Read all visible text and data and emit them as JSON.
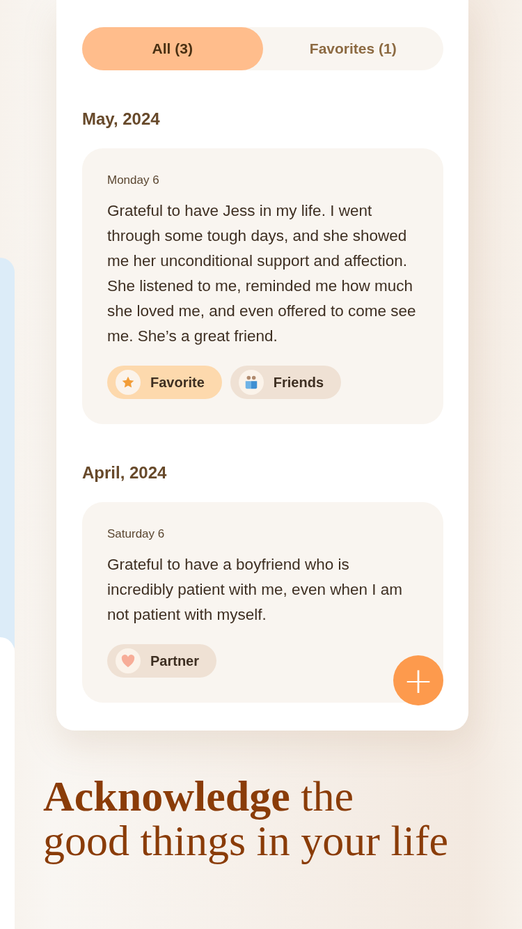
{
  "tabs": [
    {
      "label": "All (3)",
      "selected": true
    },
    {
      "label": "Favorites (1)",
      "selected": false
    }
  ],
  "sections": [
    {
      "heading": "May, 2024",
      "entries": [
        {
          "date": "Monday 6",
          "text": "Grateful to have Jess in my life. I went through some tough days, and she showed me her unconditional support and affection. She listened to me, reminded me how much she loved me, and even offered to come see me. She’s a great friend.",
          "tags": [
            {
              "kind": "favorite",
              "label": "Favorite"
            },
            {
              "kind": "friends",
              "label": "Friends"
            }
          ]
        }
      ]
    },
    {
      "heading": "April, 2024",
      "entries": [
        {
          "date": "Saturday 6",
          "text": "Grateful to have a boyfriend who is incredibly patient with me, even when I am not patient with myself.",
          "tags": [
            {
              "kind": "partner",
              "label": "Partner"
            }
          ]
        }
      ]
    }
  ],
  "add_button": {
    "label": "+"
  },
  "headline": "**Acknowledge** the\ngood things in your life"
}
